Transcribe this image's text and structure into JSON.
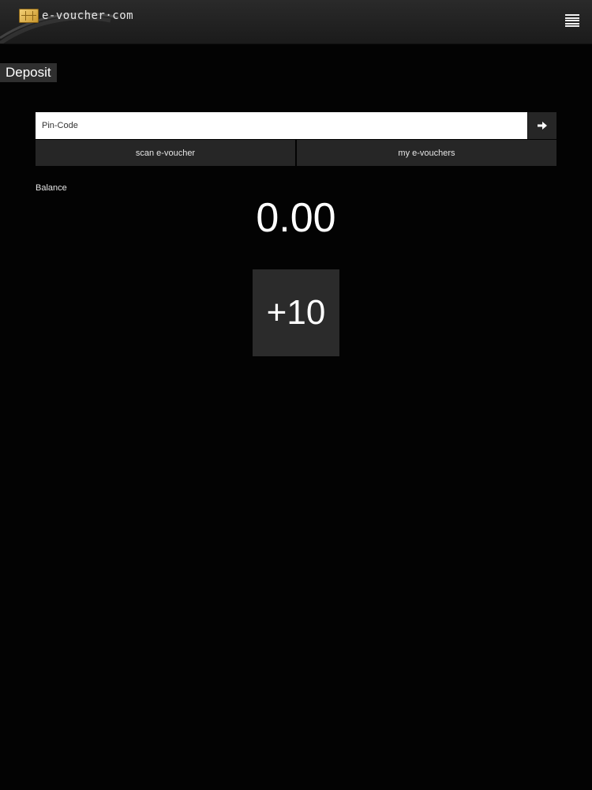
{
  "header": {
    "logo_text": "e-voucher·com",
    "logo_icon": "chip-card-icon",
    "menu_icon": "hamburger-menu-icon"
  },
  "page": {
    "title": "Deposit"
  },
  "pin": {
    "placeholder": "Pin-Code",
    "value": "",
    "submit_icon": "arrow-right-icon"
  },
  "actions": {
    "scan_label": "scan e-voucher",
    "my_vouchers_label": "my e-vouchers"
  },
  "balance": {
    "label": "Balance",
    "value": "0.00"
  },
  "quick_add": {
    "label": "+10"
  },
  "colors": {
    "background": "#030303",
    "bar": "#262626",
    "accent_gold": "#e0b24a"
  }
}
